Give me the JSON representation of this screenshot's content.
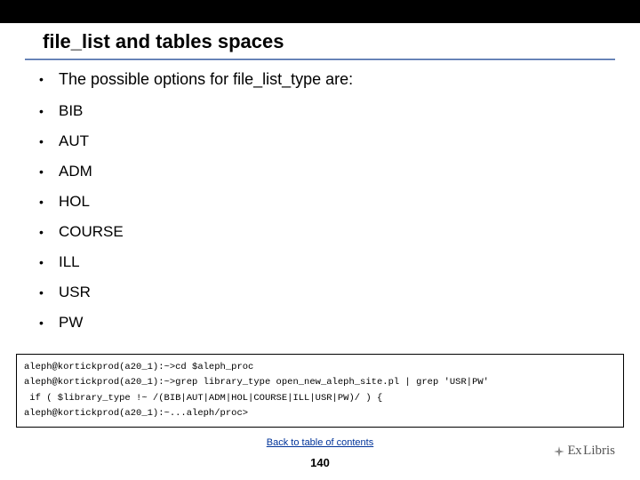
{
  "title": "file_list and tables spaces",
  "intro": "The possible options for file_list_type are:",
  "options": [
    "BIB",
    "AUT",
    "ADM",
    "HOL",
    "COURSE",
    "ILL",
    "USR",
    "PW"
  ],
  "code": {
    "line1": "aleph@kortickprod(a20_1):~>cd $aleph_proc",
    "line2": "aleph@kortickprod(a20_1):~>grep library_type open_new_aleph_site.pl | grep 'USR|PW'",
    "line3": " if ( $library_type !~ /(BIB|AUT|ADM|HOL|COURSE|ILL|USR|PW)/ ) {",
    "line4": "aleph@kortickprod(a20_1):~...aleph/proc>"
  },
  "footer": {
    "link_text": "Back to table of contents",
    "page_number": "140"
  },
  "logo": {
    "prefix": "Ex",
    "main": "Libris"
  }
}
